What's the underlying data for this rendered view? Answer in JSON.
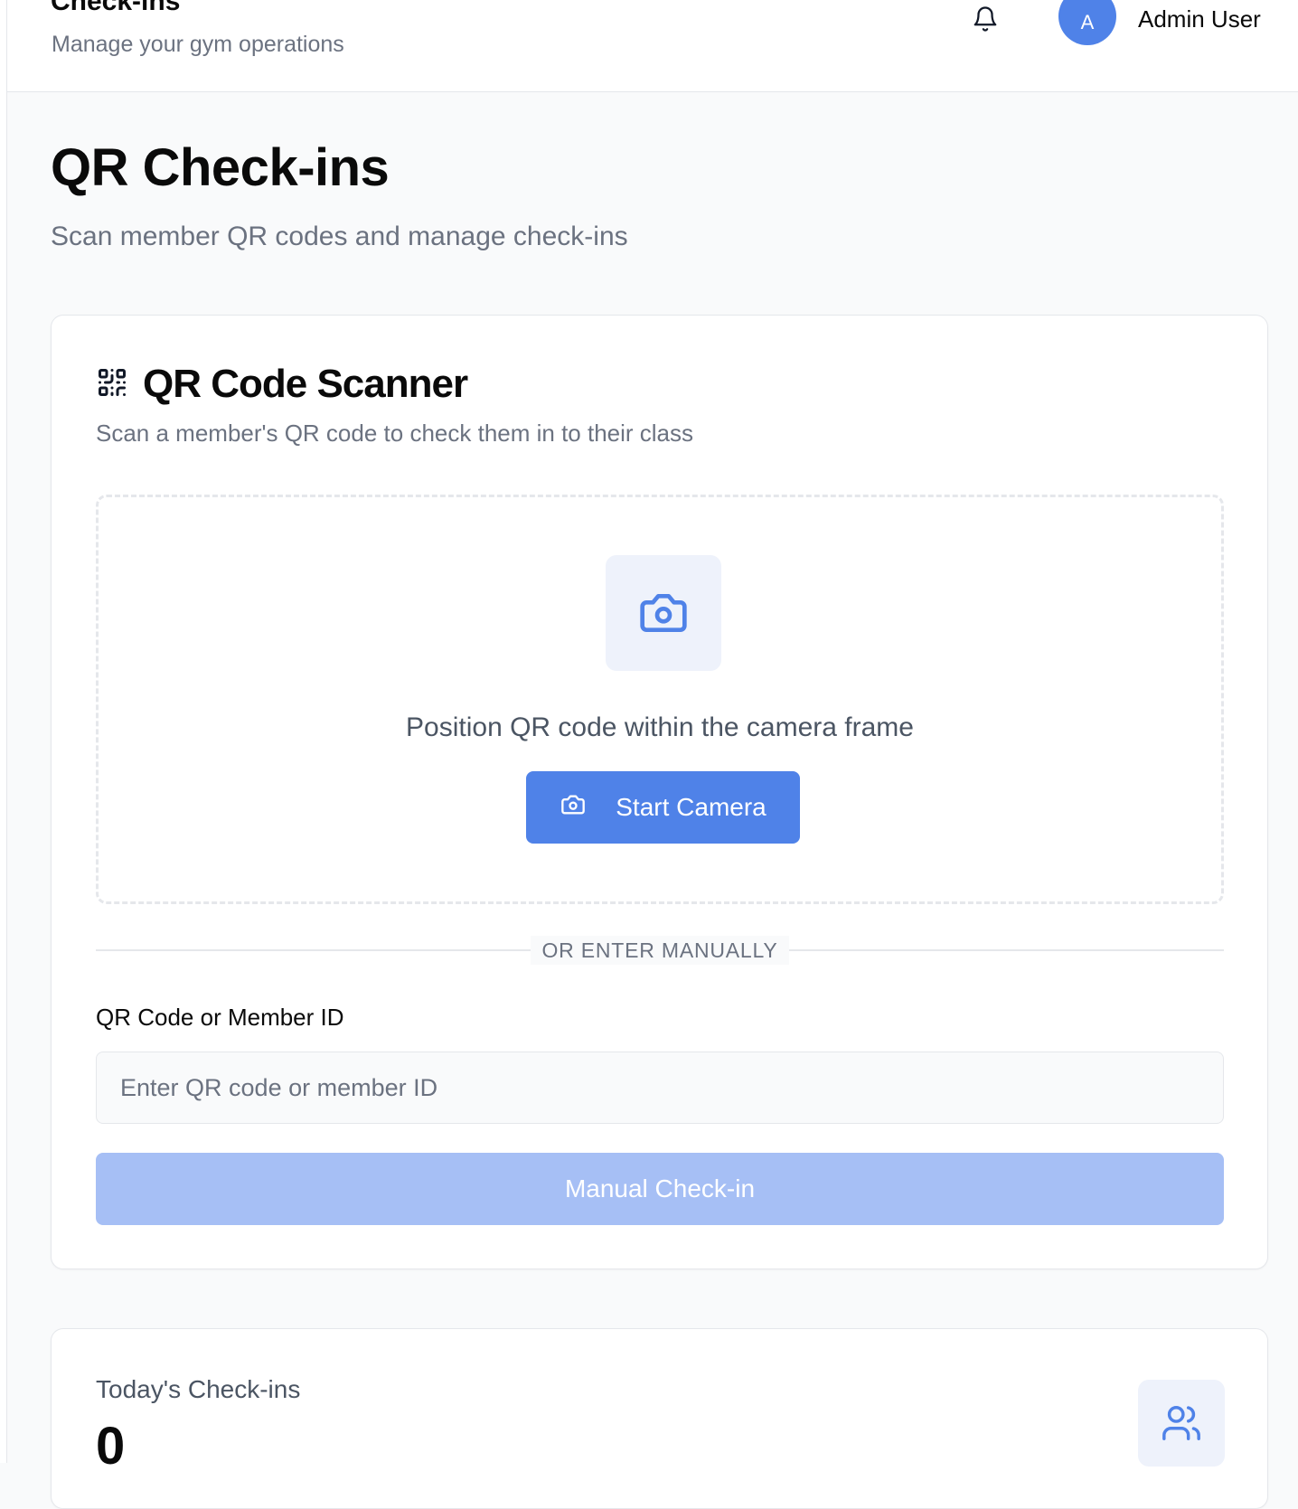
{
  "header": {
    "title": "Check-ins",
    "subtitle": "Manage your gym operations",
    "avatar_initial": "A",
    "user_name": "Admin User",
    "notification_icon": "bell-icon"
  },
  "page": {
    "title": "QR Check-ins",
    "subtitle": "Scan member QR codes and manage check-ins"
  },
  "scanner": {
    "icon": "qr-code-icon",
    "title": "QR Code Scanner",
    "description": "Scan a member's QR code to check them in to their class",
    "camera_icon": "camera-icon",
    "prompt": "Position QR code within the camera frame",
    "start_button_label": "Start Camera",
    "divider_label": "OR ENTER MANUALLY",
    "field_label": "QR Code or Member ID",
    "field_placeholder": "Enter QR code or member ID",
    "field_value": "",
    "manual_button_label": "Manual Check-in"
  },
  "stats": {
    "label": "Today's Check-ins",
    "value": "0",
    "icon": "users-icon"
  },
  "colors": {
    "accent": "#4f82e8",
    "accent_disabled": "#a6bff5",
    "tile_bg": "#eef2fb",
    "muted_text": "#6b7280",
    "border": "#e5e7eb"
  }
}
